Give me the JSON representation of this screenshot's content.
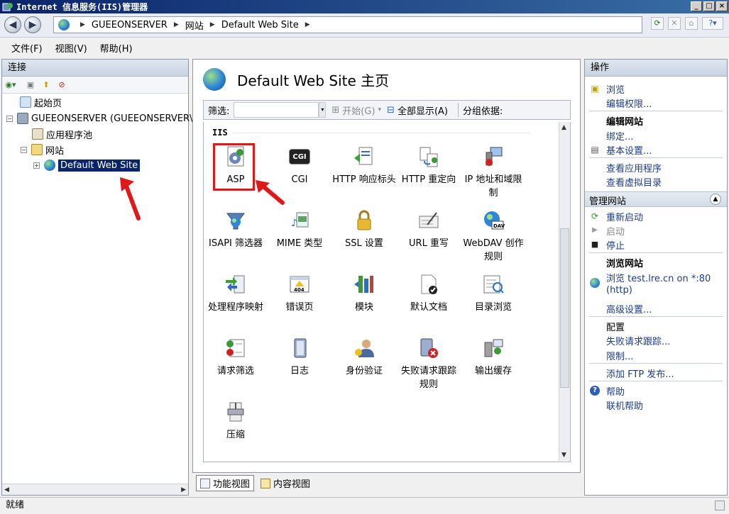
{
  "window": {
    "title": "Internet 信息服务(IIS)管理器"
  },
  "address": {
    "crumbs": [
      "GUEEONSERVER",
      "网站",
      "Default Web Site"
    ]
  },
  "menu": [
    "文件(F)",
    "视图(V)",
    "帮助(H)"
  ],
  "connections": {
    "title": "连接",
    "tree": [
      {
        "label": "起始页"
      },
      {
        "label": "GUEEONSERVER (GUEEONSERVER\\"
      },
      {
        "label": "应用程序池"
      },
      {
        "label": "网站"
      },
      {
        "label": "Default Web Site"
      }
    ]
  },
  "center": {
    "title": "Default Web Site 主页",
    "filter": {
      "label": "筛选:",
      "go": "开始(G)",
      "show_all": "全部显示(A)",
      "group_by": "分组依据:"
    },
    "group": "IIS",
    "features": [
      {
        "label": "ASP",
        "icon": "asp-icon"
      },
      {
        "label": "CGI",
        "icon": "cgi-icon"
      },
      {
        "label": "HTTP 响应标头",
        "icon": "http-headers-icon"
      },
      {
        "label": "HTTP 重定向",
        "icon": "http-redirect-icon"
      },
      {
        "label": "IP 地址和域限制",
        "icon": "ip-restrictions-icon"
      },
      {
        "label": "ISAPI 筛选器",
        "icon": "isapi-filter-icon"
      },
      {
        "label": "MIME 类型",
        "icon": "mime-types-icon"
      },
      {
        "label": "SSL 设置",
        "icon": "ssl-lock-icon"
      },
      {
        "label": "URL 重写",
        "icon": "url-rewrite-icon"
      },
      {
        "label": "WebDAV 创作规则",
        "icon": "webdav-icon"
      },
      {
        "label": "处理程序映射",
        "icon": "handler-mappings-icon"
      },
      {
        "label": "错误页",
        "icon": "error-pages-icon"
      },
      {
        "label": "模块",
        "icon": "modules-icon"
      },
      {
        "label": "默认文档",
        "icon": "default-document-icon"
      },
      {
        "label": "目录浏览",
        "icon": "directory-browsing-icon"
      },
      {
        "label": "请求筛选",
        "icon": "request-filtering-icon"
      },
      {
        "label": "日志",
        "icon": "logging-icon"
      },
      {
        "label": "身份验证",
        "icon": "authentication-icon"
      },
      {
        "label": "失败请求跟踪规则",
        "icon": "failed-request-tracing-icon"
      },
      {
        "label": "输出缓存",
        "icon": "output-caching-icon"
      },
      {
        "label": "压缩",
        "icon": "compression-icon"
      }
    ],
    "cgi_icon_text": "CGI",
    "dav_icon_text": "DAV",
    "error_icon_text": "404"
  },
  "tabs": {
    "features_view": "功能视图",
    "content_view": "内容视图"
  },
  "actions": {
    "title": "操作",
    "browse": "浏览",
    "edit_permissions": "编辑权限...",
    "edit_site": "编辑网站",
    "bindings": "绑定...",
    "basic_settings": "基本设置...",
    "view_apps": "查看应用程序",
    "view_vdirs": "查看虚拟目录",
    "manage_site": "管理网站",
    "restart": "重新启动",
    "start": "启动",
    "stop": "停止",
    "browse_site": "浏览网站",
    "browse_link_1": "浏览 test.lre.cn on *:80",
    "browse_link_2": "(http)",
    "advanced_settings": "高级设置...",
    "configure": "配置",
    "failed_tracing": "失败请求跟踪...",
    "limits": "限制...",
    "add_ftp": "添加 FTP 发布...",
    "help": "帮助",
    "online_help": "联机帮助"
  },
  "status": {
    "text": "就绪"
  },
  "colors": {
    "highlight_red": "#e01818",
    "selection": "#0a246a",
    "link": "#1e3c8c"
  }
}
